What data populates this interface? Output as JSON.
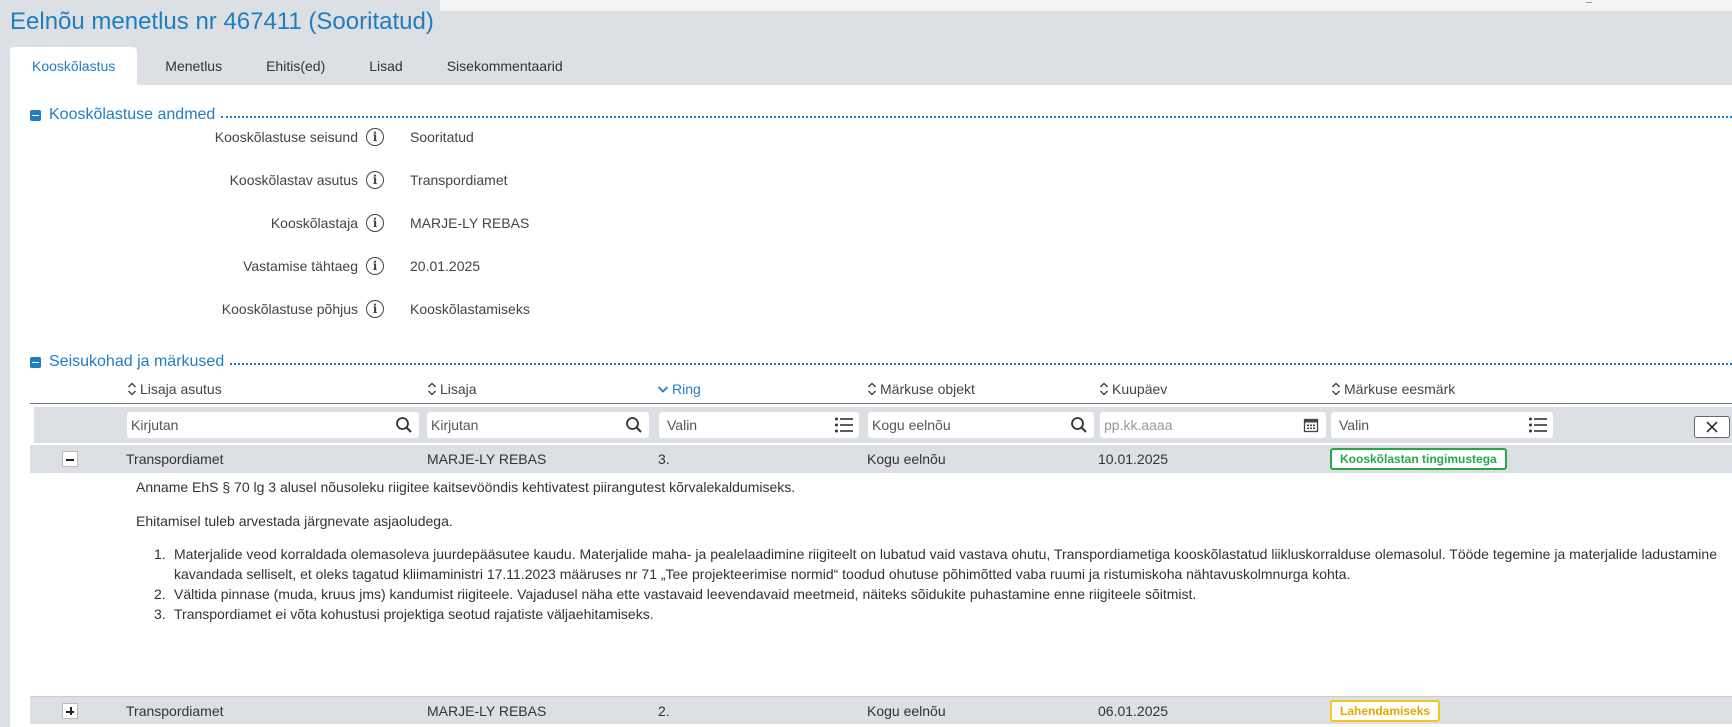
{
  "page": {
    "title": "Eelnõu menetlus nr 467411 (Sooritatud)"
  },
  "tabs": [
    {
      "label": "Kooskõlastus",
      "active": true
    },
    {
      "label": "Menetlus"
    },
    {
      "label": "Ehitis(ed)"
    },
    {
      "label": "Lisad"
    },
    {
      "label": "Sisekommentaarid"
    }
  ],
  "approval_section": {
    "title": "Kooskõlastuse andmed",
    "fields": [
      {
        "label": "Kooskõlastuse seisund",
        "value": "Sooritatud"
      },
      {
        "label": "Kooskõlastav asutus",
        "value": "Transpordiamet"
      },
      {
        "label": "Kooskõlastaja",
        "value": "MARJE-LY REBAS"
      },
      {
        "label": "Vastamise tähtaeg",
        "value": "20.01.2025"
      },
      {
        "label": "Kooskõlastuse põhjus",
        "value": "Kooskõlastamiseks"
      }
    ]
  },
  "comments_section": {
    "title": "Seisukohad ja märkused",
    "columns": [
      {
        "label": "Lisaja asutus",
        "sort": "both"
      },
      {
        "label": "Lisaja",
        "sort": "both"
      },
      {
        "label": "Ring",
        "sort": "desc",
        "active": true
      },
      {
        "label": "Märkuse objekt",
        "sort": "both"
      },
      {
        "label": "Kuupäev",
        "sort": "both"
      },
      {
        "label": "Märkuse eesmärk",
        "sort": "both"
      }
    ],
    "filters": {
      "institution": {
        "value": "Kirjutan"
      },
      "author": {
        "value": "Kirjutan"
      },
      "round": {
        "value": "Valin"
      },
      "object": {
        "value": "Kogu eelnõu"
      },
      "date": {
        "placeholder": "pp.kk.aaaa"
      },
      "purpose": {
        "value": "Valin"
      }
    },
    "rows": [
      {
        "expanded": true,
        "institution": "Transpordiamet",
        "author": "MARJE-LY REBAS",
        "round": "3.",
        "object": "Kogu eelnõu",
        "date": "10.01.2025",
        "purpose": "Kooskõlastan tingimustega",
        "purpose_color": "#28a745",
        "detail": {
          "p1": "Anname EhS § 70 lg 3 alusel nõusoleku riigitee kaitsevööndis kehtivatest piirangutest kõrvalekaldumiseks.",
          "p2": "Ehitamisel tuleb arvestada järgnevate asjaoludega.",
          "items": [
            {
              "num": "1.",
              "text": "Materjalide veod korraldada olemasoleva juurdepääsutee kaudu. Materjalide maha- ja pealelaadimine riigiteelt on lubatud vaid vastava ohutu, Transpordiametiga kooskõlastatud liikluskorralduse olemasolul. Tööde tegemine ja materjalide ladustamine kavandada selliselt, et oleks tagatud kliimaministri 17.11.2023 määruses nr 71 „Tee projekteerimise normid“ toodud ohutuse põhimõtted vaba ruumi ja ristumiskoha nähtavuskolmnurga kohta."
            },
            {
              "num": "2.",
              "text": "Vältida pinnase (muda, kruus jms) kandumist riigiteele. Vajadusel näha ette vastavaid leevendavaid meetmeid, näiteks sõidukite puhastamine enne riigiteele sõitmist."
            },
            {
              "num": "3.",
              "text": "Transpordiamet ei võta kohustusi projektiga seotud rajatiste väljaehitamiseks."
            }
          ]
        }
      },
      {
        "expanded": false,
        "institution": "Transpordiamet",
        "author": "MARJE-LY REBAS",
        "round": "2.",
        "object": "Kogu eelnõu",
        "date": "06.01.2025",
        "purpose": "Lahendamiseks",
        "purpose_color": "#f5c51a"
      }
    ]
  }
}
